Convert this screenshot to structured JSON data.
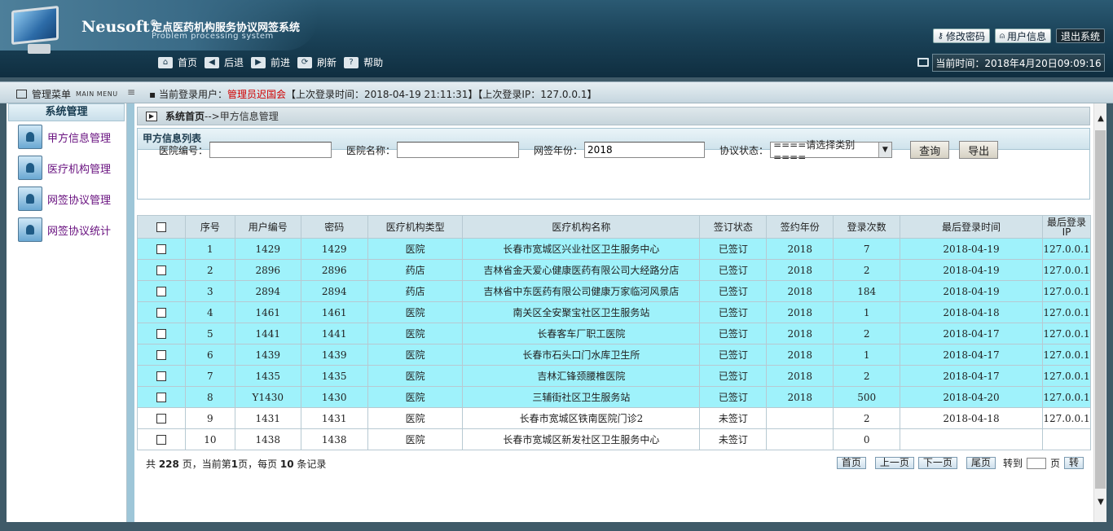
{
  "header": {
    "brand": "Neusoft",
    "brand_mark": "®",
    "system_title": "定点医药机构服务协议网签系统",
    "system_subtitle": "Problem processing system",
    "actions": {
      "change_password": "修改密码",
      "user_info": "用户信息",
      "logout": "退出系统"
    },
    "nav": {
      "home": "首页",
      "back": "后退",
      "forward": "前进",
      "refresh": "刷新",
      "help": "帮助"
    },
    "clock_text": "当前时间：2018年4月20日09:09:16"
  },
  "info_bar": {
    "menu_title": "管理菜单",
    "menu_title_en": "MAIN MENU",
    "login_prefix": "当前登录用户：",
    "login_user": "管理员迟国会",
    "login_suffix": "【上次登录时间：2018-04-19 21:11:31】【上次登录IP：127.0.0.1】"
  },
  "sidebar": {
    "heading": "系统管理",
    "items": [
      {
        "label": "甲方信息管理"
      },
      {
        "label": "医疗机构管理"
      },
      {
        "label": "网签协议管理"
      },
      {
        "label": "网签协议统计"
      }
    ]
  },
  "breadcrumb": {
    "home": "系统首页",
    "current": "-->甲方信息管理"
  },
  "list": {
    "title": "甲方信息列表",
    "filters": {
      "hospital_code_label": "医院编号：",
      "hospital_code_value": "",
      "hospital_name_label": "医院名称：",
      "hospital_name_value": "",
      "year_label": "网签年份：",
      "year_value": "2018",
      "status_label": "协议状态：",
      "status_value": "====请选择类别====",
      "query_button": "查询",
      "export_button": "导出"
    }
  },
  "table": {
    "headers": [
      "序号",
      "用户编号",
      "密码",
      "医疗机构类型",
      "医疗机构名称",
      "签订状态",
      "签约年份",
      "登录次数",
      "最后登录时间",
      "最后登录IP"
    ],
    "rows": [
      {
        "no": "1",
        "user": "1429",
        "pwd": "1429",
        "type": "医院",
        "name": "长春市宽城区兴业社区卫生服务中心",
        "status": "已签订",
        "year": "2018",
        "logins": "7",
        "last_time": "2018-04-19",
        "last_ip": "127.0.0.1"
      },
      {
        "no": "2",
        "user": "2896",
        "pwd": "2896",
        "type": "药店",
        "name": "吉林省金天爱心健康医药有限公司大经路分店",
        "status": "已签订",
        "year": "2018",
        "logins": "2",
        "last_time": "2018-04-19",
        "last_ip": "127.0.0.1"
      },
      {
        "no": "3",
        "user": "2894",
        "pwd": "2894",
        "type": "药店",
        "name": "吉林省中东医药有限公司健康万家临河风景店",
        "status": "已签订",
        "year": "2018",
        "logins": "184",
        "last_time": "2018-04-19",
        "last_ip": "127.0.0.1"
      },
      {
        "no": "4",
        "user": "1461",
        "pwd": "1461",
        "type": "医院",
        "name": "南关区全安聚宝社区卫生服务站",
        "status": "已签订",
        "year": "2018",
        "logins": "1",
        "last_time": "2018-04-18",
        "last_ip": "127.0.0.1"
      },
      {
        "no": "5",
        "user": "1441",
        "pwd": "1441",
        "type": "医院",
        "name": "长春客车厂职工医院",
        "status": "已签订",
        "year": "2018",
        "logins": "2",
        "last_time": "2018-04-17",
        "last_ip": "127.0.0.1"
      },
      {
        "no": "6",
        "user": "1439",
        "pwd": "1439",
        "type": "医院",
        "name": "长春市石头口门水库卫生所",
        "status": "已签订",
        "year": "2018",
        "logins": "1",
        "last_time": "2018-04-17",
        "last_ip": "127.0.0.1"
      },
      {
        "no": "7",
        "user": "1435",
        "pwd": "1435",
        "type": "医院",
        "name": "吉林汇锋颈腰椎医院",
        "status": "已签订",
        "year": "2018",
        "logins": "2",
        "last_time": "2018-04-17",
        "last_ip": "127.0.0.1"
      },
      {
        "no": "8",
        "user": "Y1430",
        "pwd": "1430",
        "type": "医院",
        "name": "三辅街社区卫生服务站",
        "status": "已签订",
        "year": "2018",
        "logins": "500",
        "last_time": "2018-04-20",
        "last_ip": "127.0.0.1"
      },
      {
        "no": "9",
        "user": "1431",
        "pwd": "1431",
        "type": "医院",
        "name": "长春市宽城区铁南医院门诊2",
        "status": "未签订",
        "year": "",
        "logins": "2",
        "last_time": "2018-04-18",
        "last_ip": "127.0.0.1"
      },
      {
        "no": "10",
        "user": "1438",
        "pwd": "1438",
        "type": "医院",
        "name": "长春市宽城区新发社区卫生服务中心",
        "status": "未签订",
        "year": "",
        "logins": "0",
        "last_time": "",
        "last_ip": ""
      }
    ]
  },
  "pagination": {
    "summary_prefix": "共 ",
    "total_pages": "228",
    "summary_mid1": " 页，当前第",
    "current_page": "1",
    "summary_mid2": "页，每页 ",
    "per_page": "10",
    "summary_suffix": " 条记录",
    "first": "首页",
    "prev": "上一页",
    "next": "下一页",
    "last": "尾页",
    "goto_label": "转到",
    "page_label": "页",
    "go_button": "转"
  }
}
